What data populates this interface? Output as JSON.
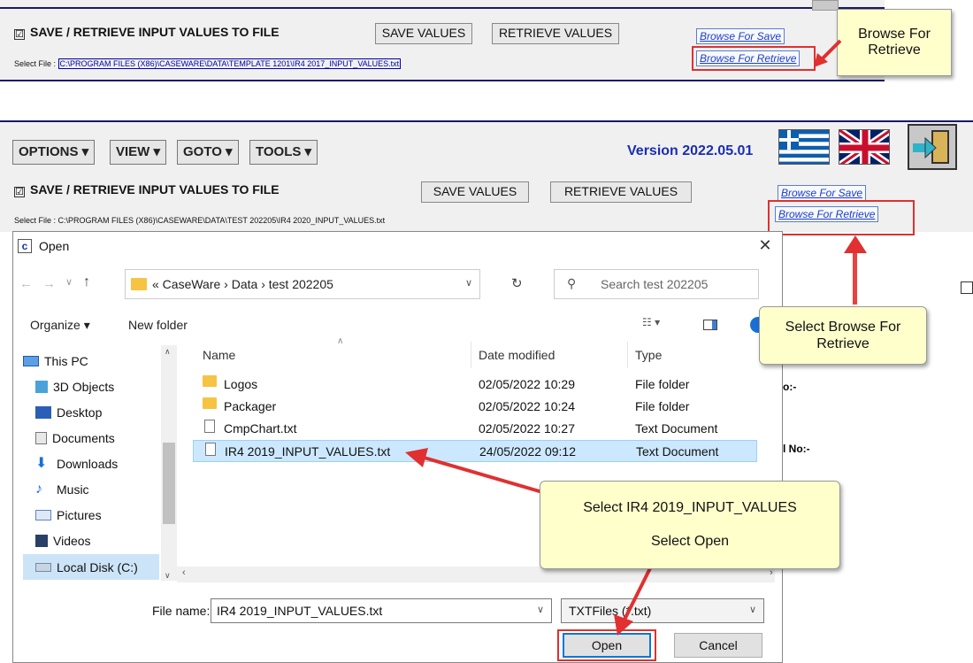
{
  "top_panel": {
    "header": "SAVE /  RETRIEVE INPUT VALUES TO FILE",
    "checkbox_mark": "☑",
    "save_values": "SAVE VALUES",
    "retrieve_values": "RETRIEVE VALUES",
    "browse_save": "Browse For Save",
    "browse_retrieve": "Browse For Retrieve",
    "select_file_label": "Select File :",
    "select_file_path": "C:\\PROGRAM FILES (X86)\\CASEWARE\\DATA\\TEMPLATE 1201\\IR4 2017_INPUT_VALUES.txt",
    "callout": "Browse For Retrieve"
  },
  "mid_panel": {
    "menus": [
      "OPTIONS ▾",
      "VIEW ▾",
      "GOTO ▾",
      "TOOLS ▾"
    ],
    "version": "Version 2022.05.01",
    "header": "SAVE /  RETRIEVE INPUT VALUES TO FILE",
    "checkbox_mark": "☑",
    "save_values": "SAVE VALUES",
    "retrieve_values": "RETRIEVE VALUES",
    "browse_save": "Browse For Save",
    "browse_retrieve": "Browse For Retrieve",
    "select_file_label": "Select File :",
    "select_file_path": "C:\\PROGRAM FILES (X86)\\CASEWARE\\DATA\\TEST 202205\\IR4 2020_INPUT_VALUES.txt",
    "callout": "Select Browse For Retrieve"
  },
  "dialog": {
    "title": "Open",
    "app_icon": "c",
    "close": "✕",
    "breadcrumb": "« CaseWare › Data › test 202205",
    "search_placeholder": "Search test 202205",
    "organize": "Organize ▾",
    "new_folder": "New folder",
    "nav": [
      {
        "label": "This PC",
        "icon": "pc"
      },
      {
        "label": "3D Objects",
        "icon": "cube"
      },
      {
        "label": "Desktop",
        "icon": "desktop"
      },
      {
        "label": "Documents",
        "icon": "doc"
      },
      {
        "label": "Downloads",
        "icon": "download"
      },
      {
        "label": "Music",
        "icon": "music"
      },
      {
        "label": "Pictures",
        "icon": "pictures"
      },
      {
        "label": "Videos",
        "icon": "videos"
      },
      {
        "label": "Local Disk (C:)",
        "icon": "disk"
      }
    ],
    "columns": {
      "name": "Name",
      "date": "Date modified",
      "type": "Type"
    },
    "files": [
      {
        "name": "Logos",
        "date": "02/05/2022 10:29",
        "type": "File folder",
        "icon": "folder"
      },
      {
        "name": "Packager",
        "date": "02/05/2022 10:24",
        "type": "File folder",
        "icon": "folder"
      },
      {
        "name": "CmpChart.txt",
        "date": "02/05/2022 10:27",
        "type": "Text Document",
        "icon": "doc"
      },
      {
        "name": "IR4 2019_INPUT_VALUES.txt",
        "date": "24/05/2022 09:12",
        "type": "Text Document",
        "icon": "doc"
      }
    ],
    "file_name_label": "File name:",
    "file_name_value": "IR4 2019_INPUT_VALUES.txt",
    "file_type": "TXTFiles (*.txt)",
    "open": "Open",
    "cancel": "Cancel",
    "callout_line1": "Select IR4 2019_INPUT_VALUES",
    "callout_line2": "Select Open"
  },
  "background_right": {
    "text1": "o:-",
    "text2": "l No:-"
  },
  "colors": {
    "accent_blue": "#1a2eb0",
    "annotation_red": "#e03030",
    "callout_bg": "#ffffcc",
    "selection": "#cce8ff"
  }
}
